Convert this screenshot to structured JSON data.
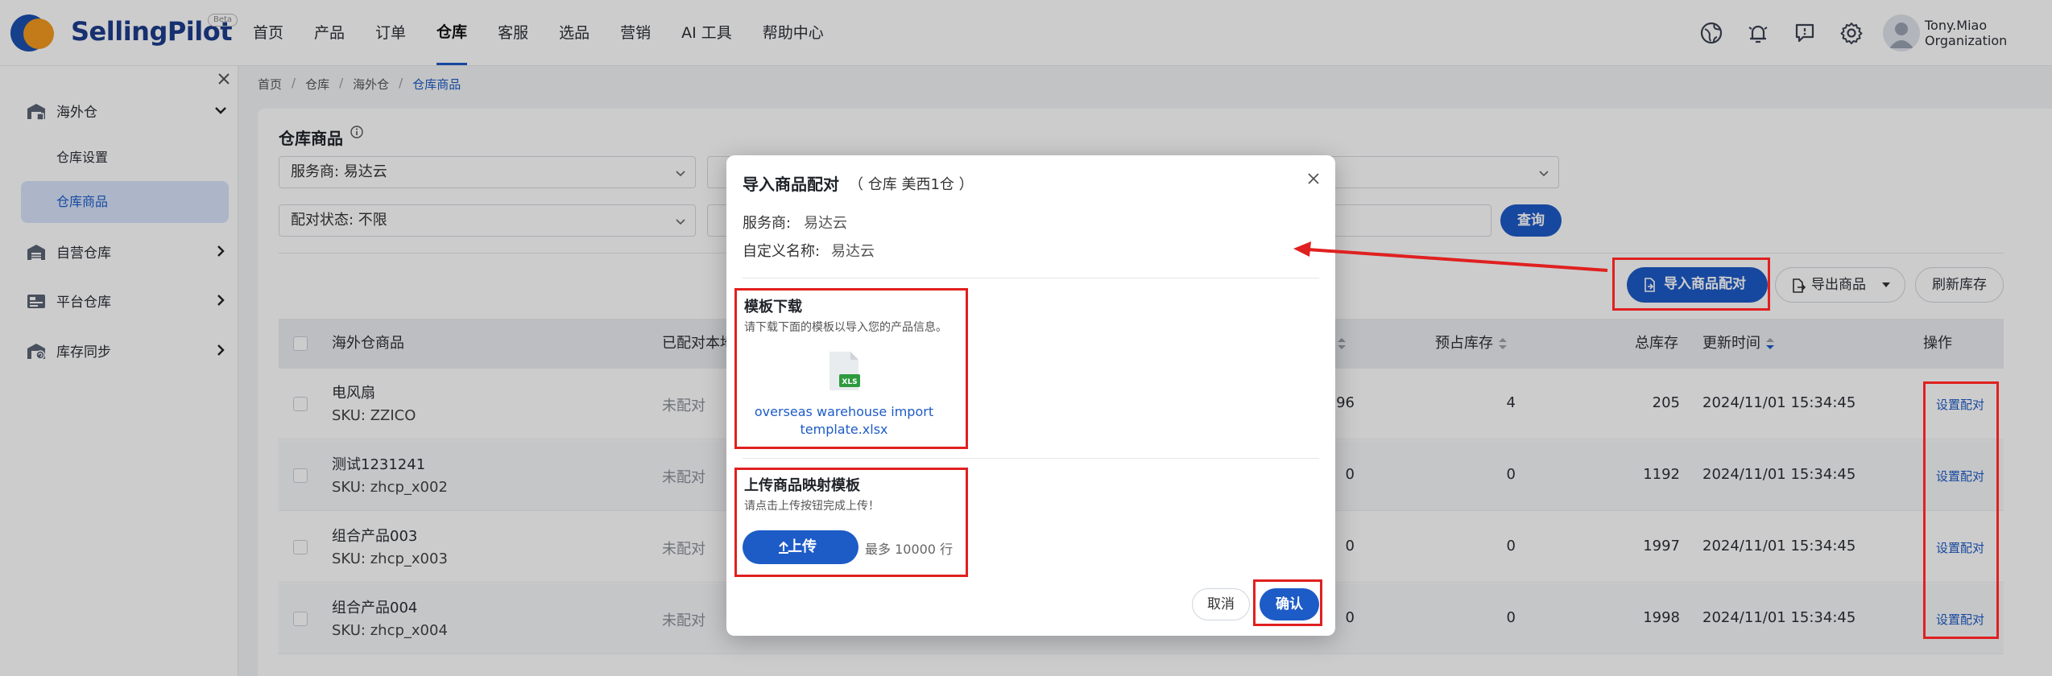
{
  "brand": {
    "name_part1": "Selling",
    "name_part2": "Pilot",
    "badge": "Beta"
  },
  "topnav": {
    "menu": [
      "首页",
      "产品",
      "订单",
      "仓库",
      "客服",
      "选品",
      "营销",
      "AI 工具",
      "帮助中心"
    ],
    "active": "仓库",
    "icons": [
      "globe-icon",
      "bell-icon",
      "chat-icon",
      "gear-icon"
    ],
    "user": {
      "name": "Tony.Miao",
      "org": "Organization"
    }
  },
  "sidebar": {
    "groups": [
      {
        "label": "海外仓",
        "icon": "warehouse-icon",
        "expanded": true,
        "items": [
          {
            "label": "仓库设置"
          },
          {
            "label": "仓库商品",
            "active": true
          }
        ]
      },
      {
        "label": "自营仓库",
        "icon": "warehouse-icon"
      },
      {
        "label": "平台仓库",
        "icon": "platform-icon"
      },
      {
        "label": "库存同步",
        "icon": "sync-icon"
      }
    ]
  },
  "breadcrumb": [
    "首页",
    "仓库",
    "海外仓",
    "仓库商品"
  ],
  "page": {
    "title": "仓库商品",
    "filters": {
      "provider": "服务商: 易达云",
      "status": "配对状态: 不限"
    },
    "query_label": "查询",
    "actions": {
      "import": "导入商品配对",
      "export": "导出商品",
      "refresh": "刷新库存"
    }
  },
  "table": {
    "headers": {
      "product": "海外仓商品",
      "matched": "已配对本地",
      "reserved": "预占库存",
      "total": "总库存",
      "updated": "更新时间",
      "ops": "操作"
    },
    "rows": [
      {
        "name": "电风扇",
        "sku": "SKU: ZZICO",
        "status": "未配对",
        "available": "96",
        "reserved": "4",
        "total": "205",
        "updated": "2024/11/01 15:34:45",
        "op": "设置配对"
      },
      {
        "name": "测试1231241",
        "sku": "SKU: zhcp_x002",
        "status": "未配对",
        "available": "0",
        "reserved": "0",
        "total": "1192",
        "updated": "2024/11/01 15:34:45",
        "op": "设置配对"
      },
      {
        "name": "组合产品003",
        "sku": "SKU: zhcp_x003",
        "status": "未配对",
        "available": "0",
        "reserved": "0",
        "total": "1997",
        "updated": "2024/11/01 15:34:45",
        "op": "设置配对"
      },
      {
        "name": "组合产品004",
        "sku": "SKU: zhcp_x004",
        "status": "未配对",
        "available": "0",
        "reserved": "0",
        "total": "1998",
        "updated": "2024/11/01 15:34:45",
        "op": "设置配对"
      }
    ]
  },
  "modal": {
    "title": "导入商品配对",
    "subtitle": "（ 仓库 美西1仓 ）",
    "provider_label": "服务商:",
    "provider_value": "易达云",
    "custom_label": "自定义名称:",
    "custom_value": "易达云",
    "template": {
      "title": "模板下载",
      "desc": "请下载下面的模板以导入您的产品信息。",
      "file_badge": "XLS",
      "file_name": "overseas warehouse import template.xlsx"
    },
    "upload": {
      "title": "上传商品映射模板",
      "desc": "请点击上传按钮完成上传！",
      "button": "上传",
      "limit": "最多 10000 行"
    },
    "cancel": "取消",
    "confirm": "确认"
  },
  "colors": {
    "primary": "#1d5bc7",
    "annotation": "#e02020",
    "brand_orange": "#f39a1f",
    "brand_blue": "#1c4fb0"
  }
}
